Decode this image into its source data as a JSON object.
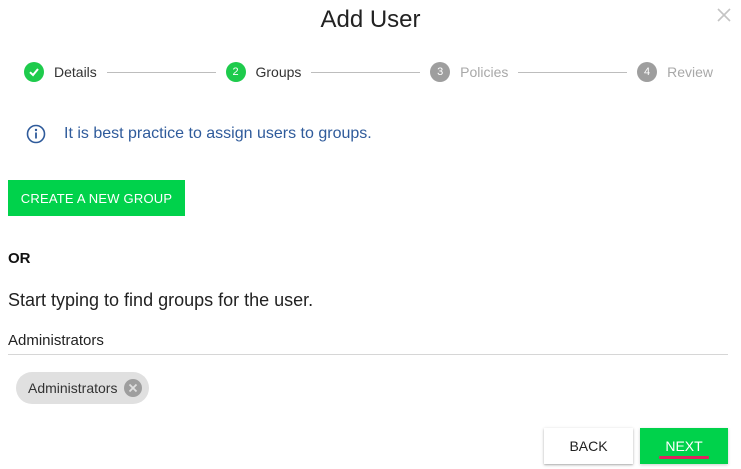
{
  "dialog": {
    "title": "Add User",
    "close_icon": "close-icon"
  },
  "stepper": {
    "steps": [
      {
        "number": "",
        "label": "Details",
        "state": "done"
      },
      {
        "number": "2",
        "label": "Groups",
        "state": "active"
      },
      {
        "number": "3",
        "label": "Policies",
        "state": "todo"
      },
      {
        "number": "4",
        "label": "Review",
        "state": "todo"
      }
    ]
  },
  "info": {
    "icon": "info-icon",
    "text": "It is best practice to assign users to groups."
  },
  "create_group_button": "CREATE A NEW GROUP",
  "or_label": "OR",
  "search": {
    "hint": "Start typing to find groups for the user.",
    "value": "Administrators"
  },
  "selected_groups": [
    {
      "label": "Administrators"
    }
  ],
  "footer": {
    "back_label": "BACK",
    "next_label": "NEXT"
  },
  "colors": {
    "accent_green": "#00d24b",
    "info_blue": "#2f5b9b",
    "highlight_underline": "#e0245e",
    "inactive_gray": "#9e9e9e"
  }
}
